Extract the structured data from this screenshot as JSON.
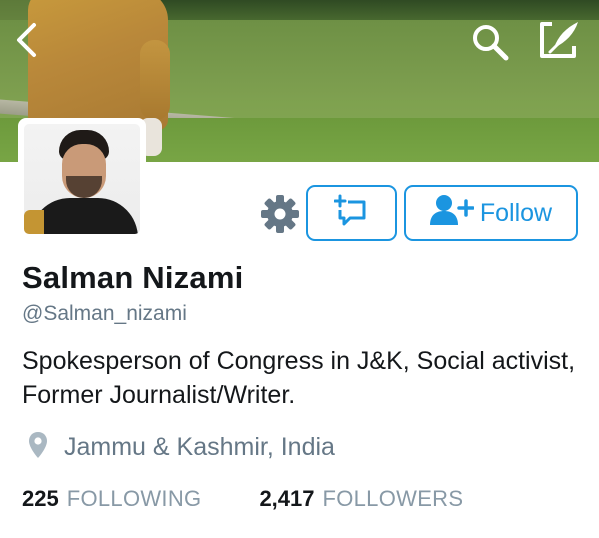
{
  "colors": {
    "accent": "#1b95e0",
    "text_primary": "#14171a",
    "text_secondary": "#657786",
    "stats_label": "#8899a6"
  },
  "header": {
    "icons": [
      "back-icon",
      "search-icon",
      "compose-icon"
    ]
  },
  "actions": {
    "settings_icon": "gear-icon",
    "message_icon": "direct-message-icon",
    "follow_label": "Follow",
    "follow_icon": "add-user-icon"
  },
  "profile": {
    "name": "Salman Nizami",
    "handle": "@Salman_nizami",
    "bio": "Spokesperson of Congress in J&K, Social activist, Former Journalist/Writer.",
    "location": "Jammu & Kashmir, India",
    "location_icon": "location-pin-icon"
  },
  "stats": {
    "following_count": "225",
    "following_label": "FOLLOWING",
    "followers_count": "2,417",
    "followers_label": "FOLLOWERS"
  }
}
